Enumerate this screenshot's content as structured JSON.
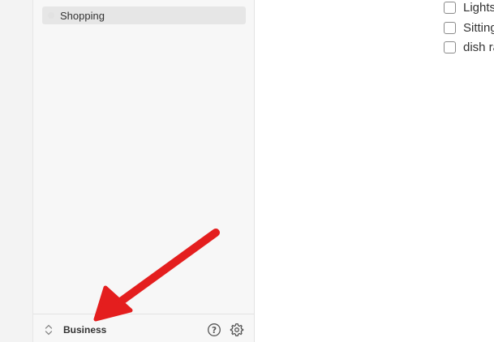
{
  "sidebar": {
    "selected_list": "Shopping"
  },
  "footer": {
    "account_name": "Business",
    "switch_icon": "chevron-up-down-icon",
    "help_icon": "question-circle-icon",
    "settings_icon": "gear-icon"
  },
  "tasks": [
    {
      "title": "Lights"
    },
    {
      "title": "Sitting"
    },
    {
      "title": "dish ra"
    }
  ],
  "colors": {
    "annotation_arrow": "#e41e1e",
    "selection": "#e6e6e6",
    "sidebar_bg": "#f7f7f7"
  }
}
